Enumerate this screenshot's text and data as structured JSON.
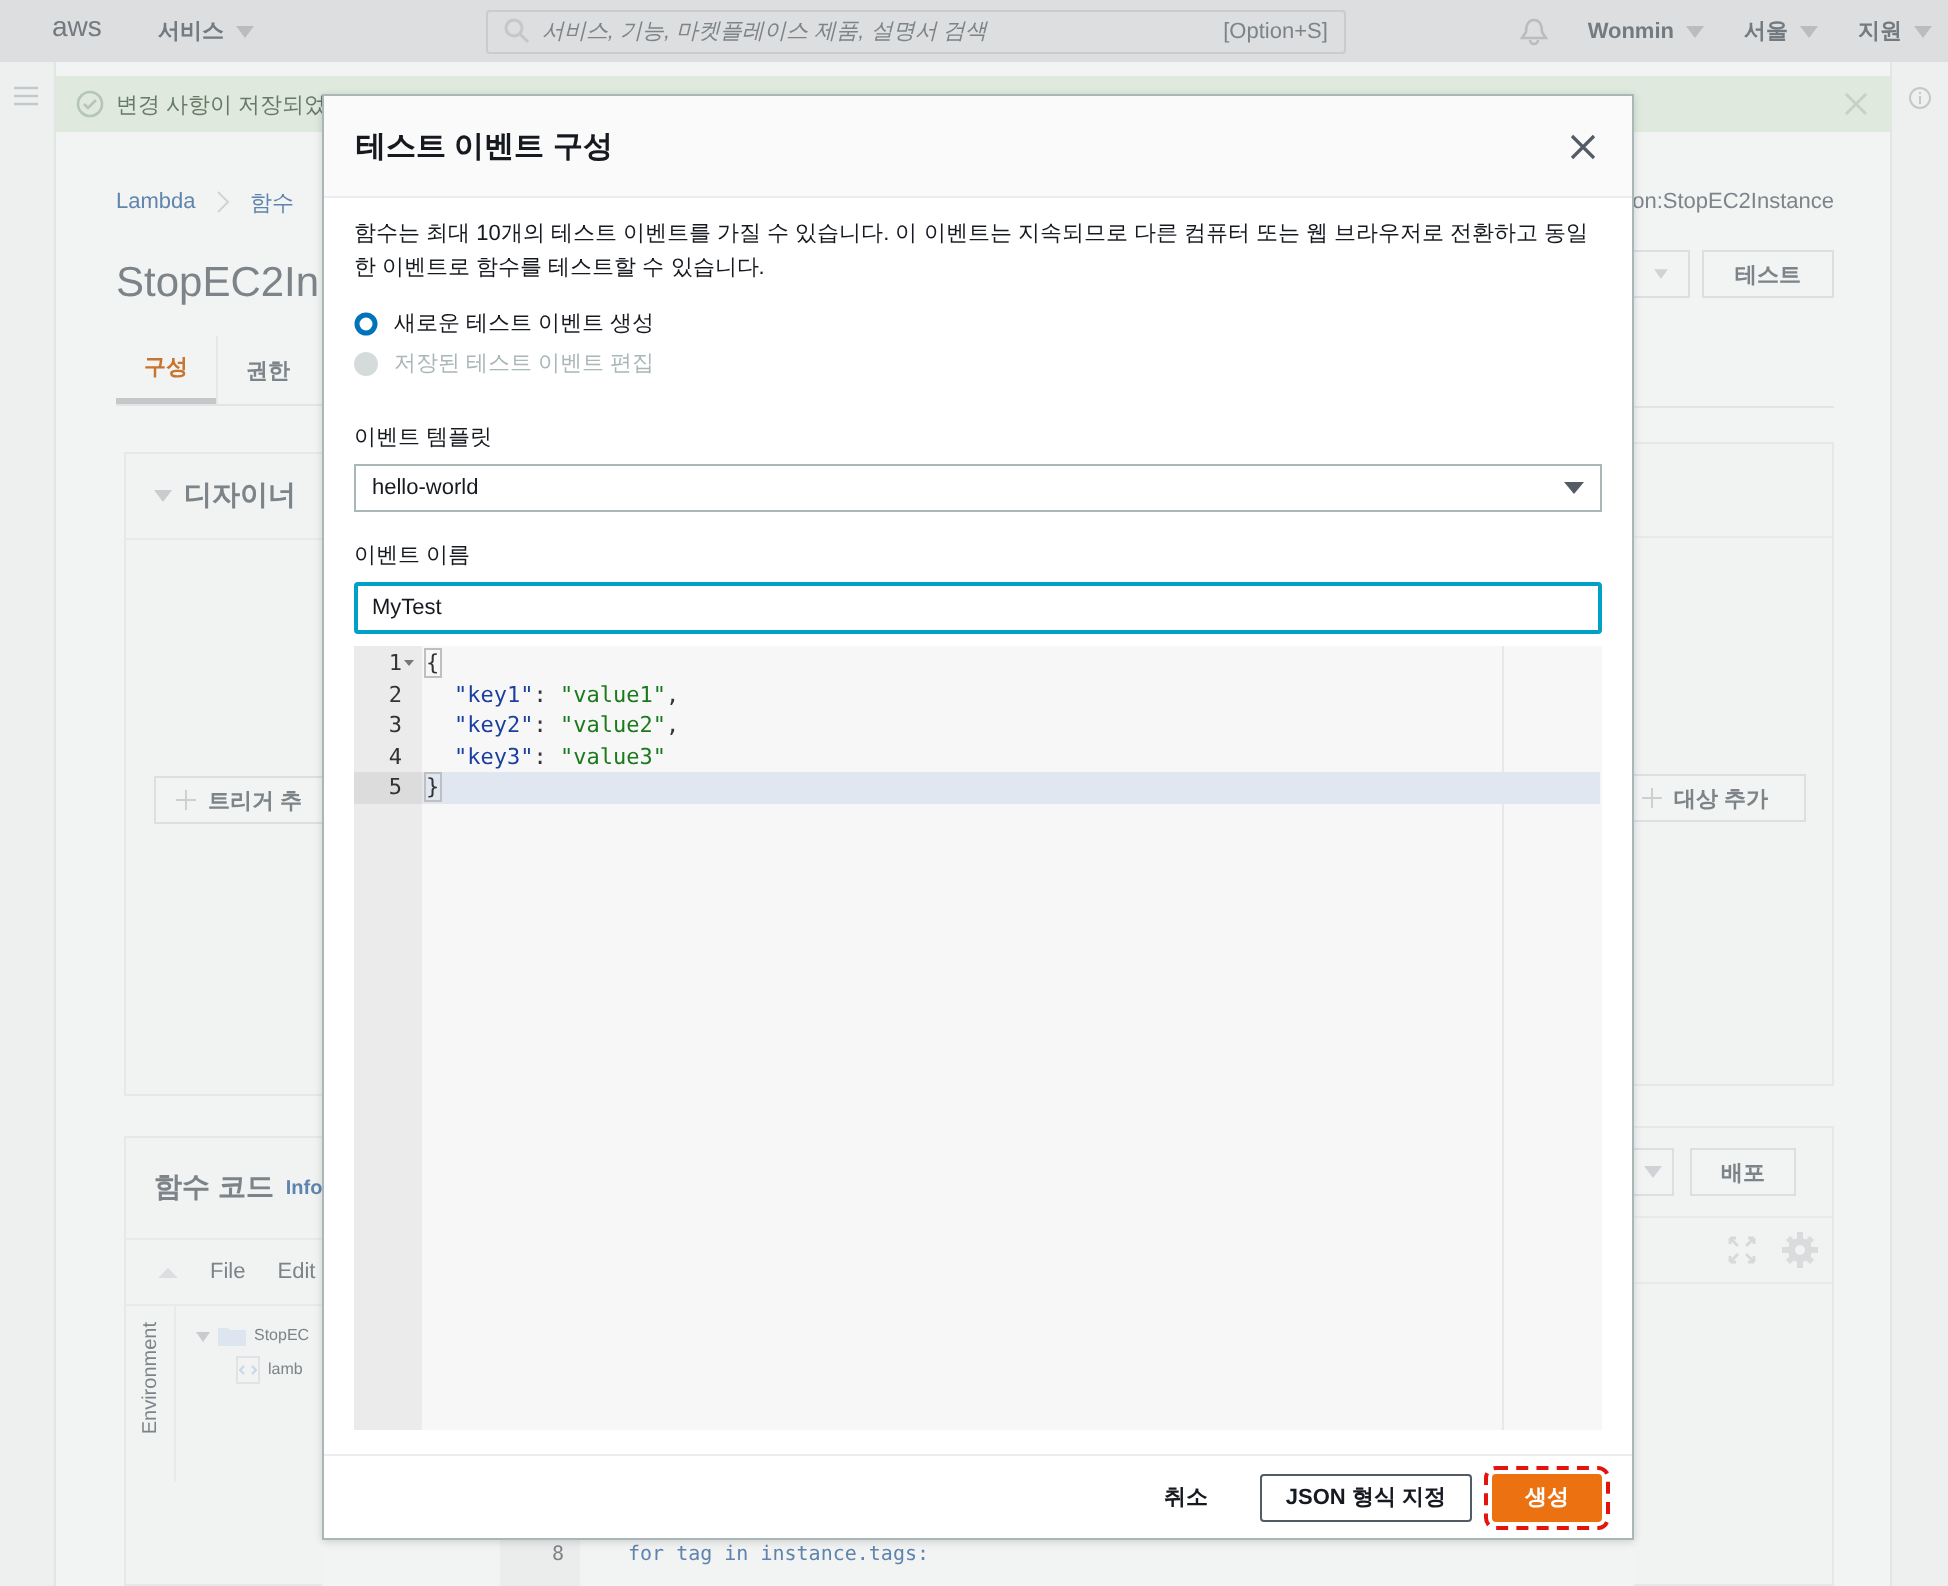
{
  "top_bar": {
    "logo": "aws",
    "services_menu": "서비스",
    "search": {
      "placeholder": "서비스, 기능, 마켓플레이스 제품, 설명서 검색",
      "shortcut": "[Option+S]"
    },
    "user_menu": "Wonmin",
    "region_menu": "서울",
    "support_menu": "지원"
  },
  "banner": {
    "message": "변경 사항이 저장되었"
  },
  "breadcrumb": [
    "Lambda",
    "함수"
  ],
  "function_arn_tail": "on:StopEC2Instance",
  "function_title": "StopEC2In",
  "test_button": "테스트",
  "page_tabs": [
    {
      "label": "구성",
      "selected": true
    },
    {
      "label": "권한",
      "selected": false
    }
  ],
  "designer": {
    "title": "디자이너",
    "add_trigger": "트리거 추",
    "add_destination": "대상 추가"
  },
  "function_code": {
    "title": "함수 코드",
    "info": "Info",
    "menu": [
      "File",
      "Edit"
    ],
    "deploy_button": "배포",
    "environment_tab": "Environment",
    "tree": [
      {
        "label": "StopEC",
        "children": [
          {
            "label": "lamb"
          }
        ]
      }
    ],
    "code_lines": [
      {
        "number": "8",
        "code": "for tag in instance.tags:"
      }
    ]
  },
  "modal": {
    "title": "테스트 이벤트 구성",
    "description": "함수는 최대 10개의 테스트 이벤트를 가질 수 있습니다. 이 이벤트는 지속되므로 다른 컴퓨터 또는 웹 브라우저로 전환하고 동일한 이벤트로 함수를 테스트할 수 있습니다.",
    "options": [
      {
        "label": "새로운 테스트 이벤트 생성",
        "selected": true,
        "disabled": false
      },
      {
        "label": "저장된 테스트 이벤트 편집",
        "selected": false,
        "disabled": true
      }
    ],
    "template": {
      "label": "이벤트 템플릿",
      "value": "hello-world"
    },
    "event_name": {
      "label": "이벤트 이름",
      "value": "MyTest"
    },
    "editor_lines": [
      {
        "number": "1",
        "highlighted": false,
        "foldable": true,
        "tokens": [
          {
            "kind": "brace",
            "text": "{"
          }
        ]
      },
      {
        "number": "2",
        "highlighted": false,
        "foldable": false,
        "tokens": [
          {
            "kind": "key",
            "text": "\"key1\""
          },
          {
            "kind": "plain",
            "text": ": "
          },
          {
            "kind": "string",
            "text": "\"value1\""
          },
          {
            "kind": "plain",
            "text": ","
          }
        ]
      },
      {
        "number": "3",
        "highlighted": false,
        "foldable": false,
        "tokens": [
          {
            "kind": "key",
            "text": "\"key2\""
          },
          {
            "kind": "plain",
            "text": ": "
          },
          {
            "kind": "string",
            "text": "\"value2\""
          },
          {
            "kind": "plain",
            "text": ","
          }
        ]
      },
      {
        "number": "4",
        "highlighted": false,
        "foldable": false,
        "tokens": [
          {
            "kind": "key",
            "text": "\"key3\""
          },
          {
            "kind": "plain",
            "text": ": "
          },
          {
            "kind": "string",
            "text": "\"value3\""
          }
        ]
      },
      {
        "number": "5",
        "highlighted": true,
        "foldable": false,
        "tokens": [
          {
            "kind": "brace",
            "text": "}"
          }
        ]
      }
    ],
    "buttons": {
      "cancel": "취소",
      "format": "JSON 형식 지정",
      "create": "생성"
    }
  }
}
